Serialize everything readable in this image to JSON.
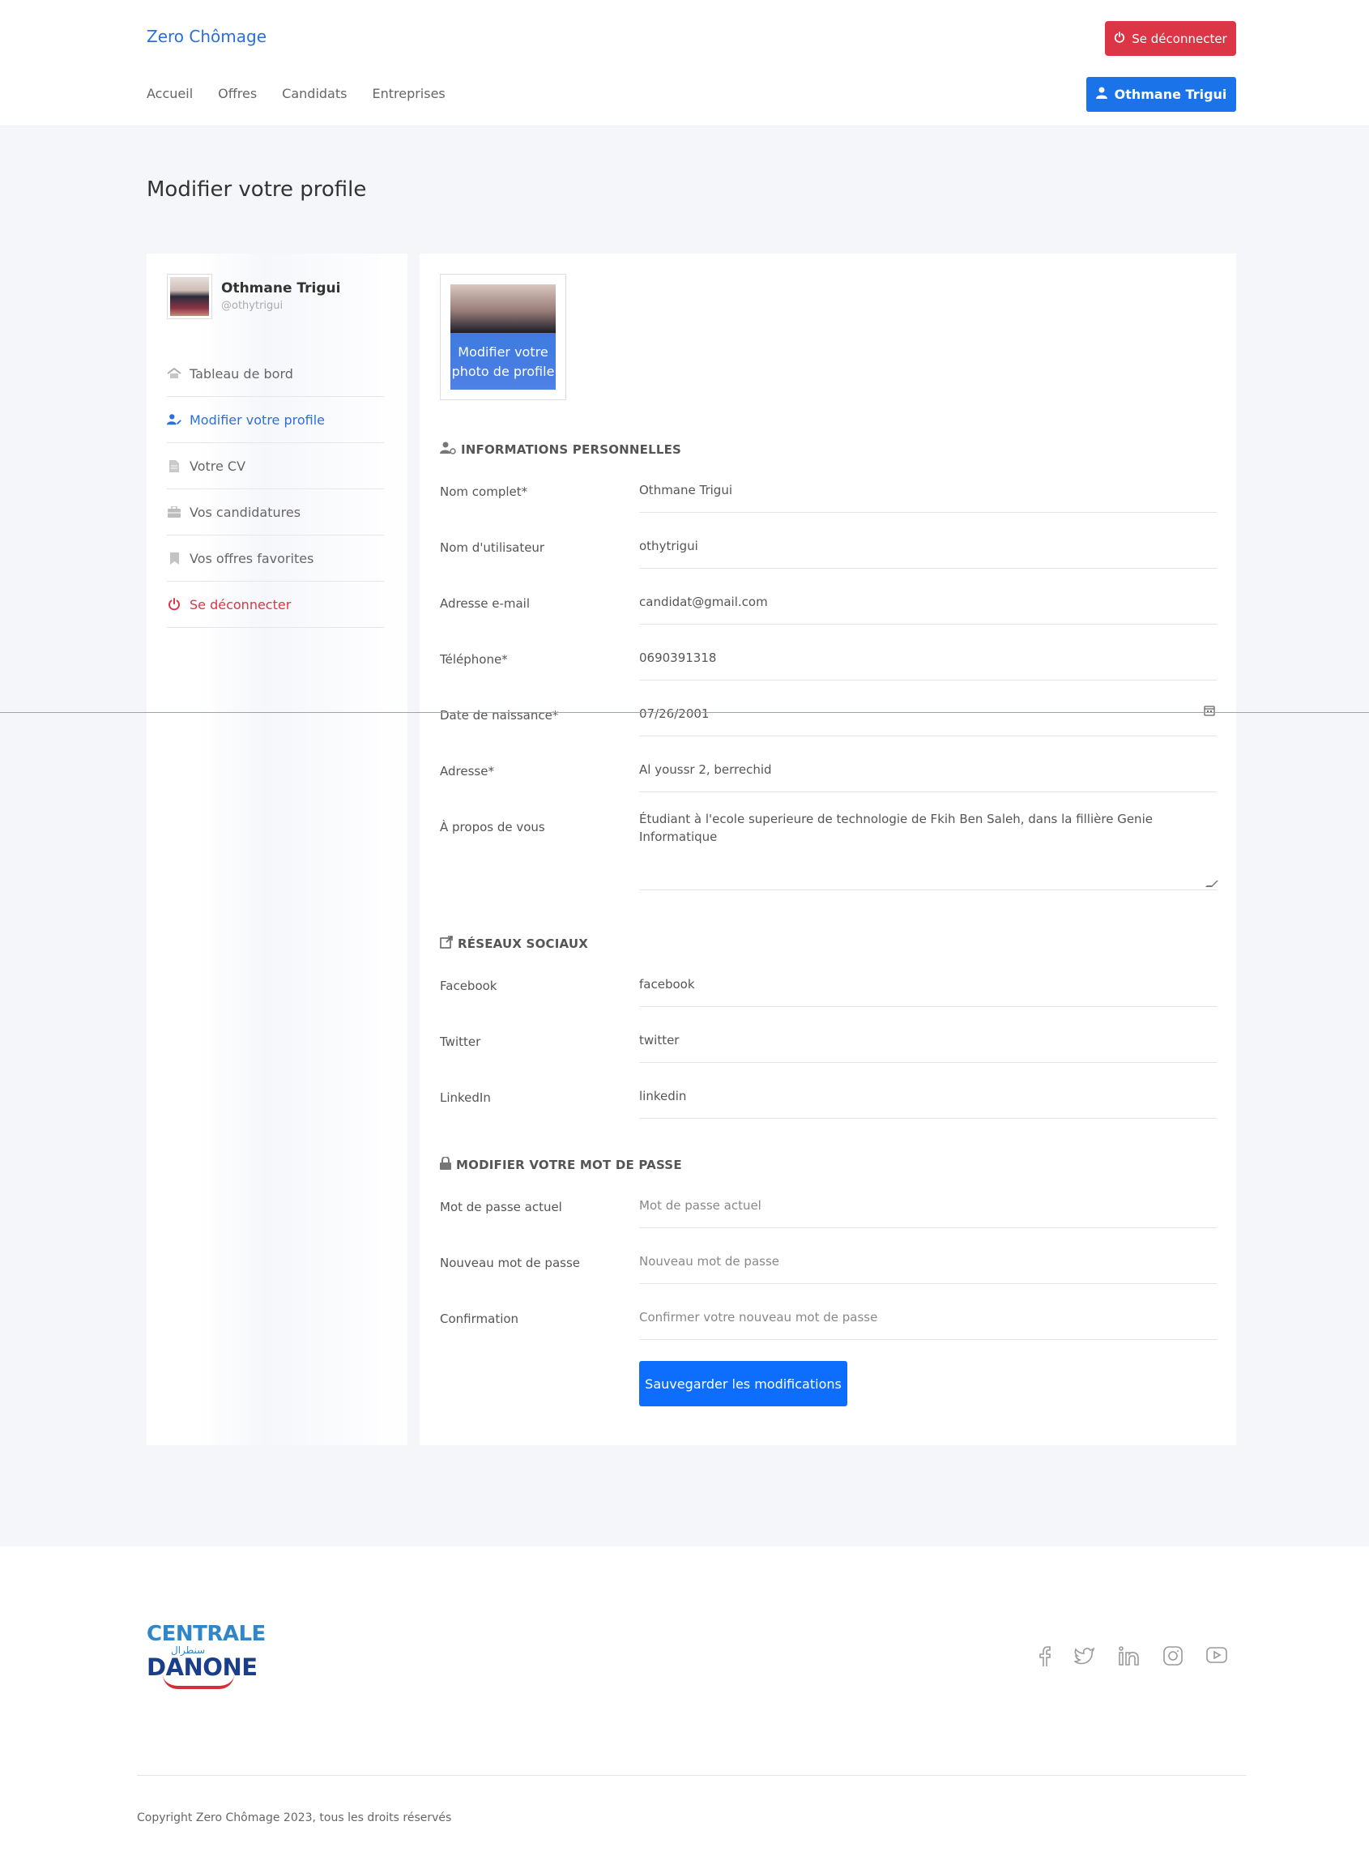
{
  "header": {
    "brand": "Zero Chômage",
    "logout_label": "Se déconnecter",
    "nav": [
      "Accueil",
      "Offres",
      "Candidats",
      "Entreprises"
    ],
    "user_button": "Othmane Trigui"
  },
  "page": {
    "title": "Modifier votre profile"
  },
  "sidebar": {
    "name": "Othmane Trigui",
    "handle": "@othytrigui",
    "items": [
      {
        "label": "Tableau de bord",
        "icon": "home-icon"
      },
      {
        "label": "Modifier votre profile",
        "icon": "user-edit-icon"
      },
      {
        "label": "Votre CV",
        "icon": "document-icon"
      },
      {
        "label": "Vos candidatures",
        "icon": "briefcase-icon"
      },
      {
        "label": "Vos offres favorites",
        "icon": "bookmark-icon"
      },
      {
        "label": "Se déconnecter",
        "icon": "power-icon"
      }
    ]
  },
  "photo": {
    "overlay": "Modifier votre photo de profile"
  },
  "sections": {
    "personal": "INFORMATIONS PERSONNELLES",
    "social": "RÉSEAUX SOCIAUX",
    "password": "MODIFIER VOTRE MOT DE PASSE"
  },
  "personal": {
    "fullname": {
      "label": "Nom complet*",
      "value": "Othmane Trigui"
    },
    "username": {
      "label": "Nom d'utilisateur",
      "value": "othytrigui"
    },
    "email": {
      "label": "Adresse e-mail",
      "value": "candidat@gmail.com"
    },
    "phone": {
      "label": "Téléphone*",
      "value": "0690391318"
    },
    "birthdate": {
      "label": "Date de naissance*",
      "value": "07/26/2001"
    },
    "address": {
      "label": "Adresse*",
      "value": "Al youssr 2, berrechid"
    },
    "about": {
      "label": "À propos de vous",
      "value": "Étudiant à l'ecole superieure de technologie de Fkih Ben Saleh, dans la fillière Genie Informatique"
    }
  },
  "social": {
    "facebook": {
      "label": "Facebook",
      "value": "facebook"
    },
    "twitter": {
      "label": "Twitter",
      "value": "twitter"
    },
    "linkedin": {
      "label": "LinkedIn",
      "value": "linkedin"
    }
  },
  "password": {
    "current": {
      "label": "Mot de passe actuel",
      "placeholder": "Mot de passe actuel"
    },
    "new": {
      "label": "Nouveau mot de passe",
      "placeholder": "Nouveau mot de passe"
    },
    "confirm": {
      "label": "Confirmation",
      "placeholder": "Confirmer votre nouveau mot de passe"
    }
  },
  "save_label": "Sauvegarder les modifications",
  "footer": {
    "logo_top": "CENTRALE",
    "logo_ar": "سنطرال",
    "logo_bottom": "DANONE",
    "copyright": "Copyright Zero Chômage 2023, tous les droits réservés"
  },
  "colors": {
    "primary": "#0d6efd",
    "danger": "#dc3545",
    "brand": "#2a6fdb"
  }
}
